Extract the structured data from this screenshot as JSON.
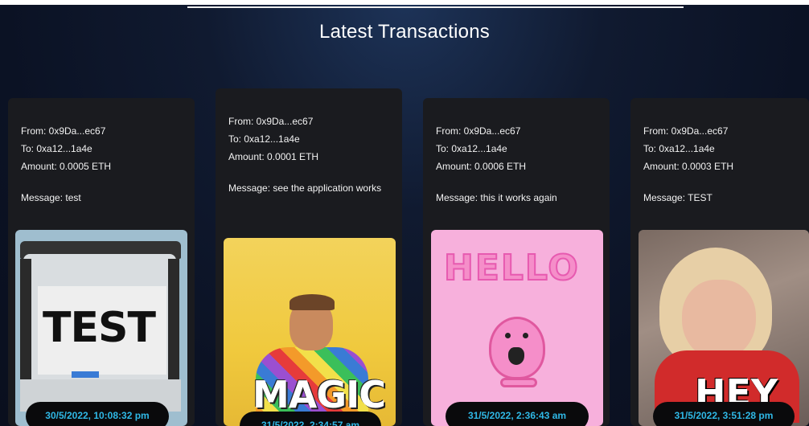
{
  "header": {
    "title": "Latest Transactions"
  },
  "transactions": [
    {
      "from": "From: 0x9Da...ec67",
      "to": "To: 0xa12...1a4e",
      "amount": "Amount: 0.0005 ETH",
      "message": "Message: test",
      "gif_text": "TEST",
      "timestamp": "30/5/2022, 10:08:32 pm"
    },
    {
      "from": "From: 0x9Da...ec67",
      "to": "To: 0xa12...1a4e",
      "amount": "Amount: 0.0001 ETH",
      "message": "Message: see the application works",
      "gif_text": "MAGIC",
      "timestamp": "31/5/2022, 2:34:57 am"
    },
    {
      "from": "From: 0x9Da...ec67",
      "to": "To: 0xa12...1a4e",
      "amount": "Amount: 0.0006 ETH",
      "message": "Message: this it works again",
      "gif_text": "HELLO",
      "timestamp": "31/5/2022, 2:36:43 am"
    },
    {
      "from": "From: 0x9Da...ec67",
      "to": "To: 0xa12...1a4e",
      "amount": "Amount: 0.0003 ETH",
      "message": "Message: TEST",
      "gif_text": "HEY",
      "timestamp": "31/5/2022, 3:51:28 pm"
    }
  ],
  "colors": {
    "background": "#0b1224",
    "card": "#1a1b1f",
    "timestamp_text": "#2fb8e6",
    "timestamp_bg": "#0a0a0c"
  }
}
